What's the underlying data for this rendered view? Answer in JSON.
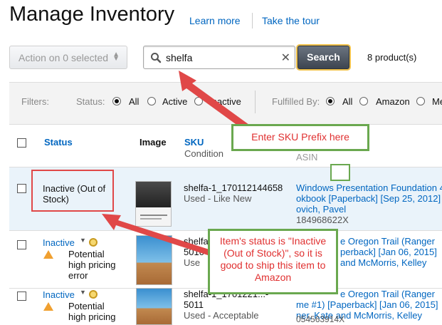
{
  "header": {
    "title": "Manage Inventory",
    "learn_more": "Learn more",
    "take_tour": "Take the tour"
  },
  "toolbar": {
    "action_label": "Action on 0 selected",
    "search_value": "shelfa",
    "search_button": "Search",
    "product_count": "8 product(s)"
  },
  "filters": {
    "label": "Filters:",
    "status_label": "Status:",
    "status_options": [
      "All",
      "Active",
      "Inactive"
    ],
    "status_selected": "All",
    "fulfilled_label": "Fulfilled By:",
    "fulfilled_options": [
      "All",
      "Amazon",
      "Me"
    ],
    "fulfilled_selected": "All"
  },
  "table": {
    "headers": {
      "status": "Status",
      "image": "Image",
      "sku": "SKU",
      "condition": "Condition",
      "asin": "ASIN"
    },
    "rows": [
      {
        "status": "Inactive (Out of Stock)",
        "sku": "shelfa-1_170112144658",
        "condition": "Used - Like New",
        "title_l1": "Windows Presentation Foundation 4",
        "title_l2": "okbook [Paperback] [Sep 25, 2012]",
        "title_l3": "ovich, Pavel",
        "asin": "184968622X"
      },
      {
        "status": "Inactive",
        "warning": "Potential high pricing error",
        "sku_l1": "shelfa",
        "sku_l2": "5010",
        "condition": "Use",
        "title_l1": "e Oregon Trail (Ranger",
        "title_l2": "perback] [Jan 06, 2015]",
        "title_l3": "and McMorris, Kelley"
      },
      {
        "status": "Inactive",
        "warning": "Potential high pricing",
        "sku_l1": "shelfa-1_1701221...-",
        "sku_l2": "5011",
        "condition": "Used - Acceptable",
        "title_l1": "e Oregon Trail (Ranger",
        "title_l2": "me #1) [Paperback] [Jan 06, 2015]",
        "title_l3": "ner, Kate and McMorris, Kelley",
        "asin": "054563914X"
      }
    ]
  },
  "annotations": {
    "sku_callout": "Enter SKU Prefix here",
    "status_callout": "Item's status is \"Inactive (Out of Stock)\", so it is good to ship this item to Amazon"
  },
  "colors": {
    "link": "#0066c0",
    "callout_border": "#6aa84f",
    "callout_text": "#e03030",
    "arrow": "#e04848",
    "selected_row": "#eaf3fa"
  }
}
